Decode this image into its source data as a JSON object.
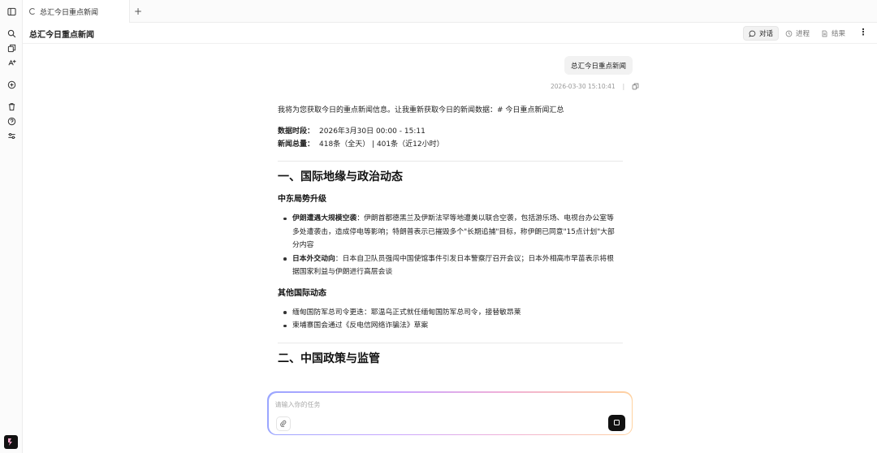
{
  "tab": {
    "title": "总汇今日重点新闻",
    "add_label": "+"
  },
  "header": {
    "title": "总汇今日重点新闻",
    "segments": [
      {
        "label": "对话",
        "icon": "chat-icon",
        "active": true
      },
      {
        "label": "进程",
        "icon": "progress-icon",
        "active": false
      },
      {
        "label": "结果",
        "icon": "document-icon",
        "active": false
      }
    ],
    "more_label": "⋮"
  },
  "user_message": {
    "text": "总汇今日重点新闻",
    "timestamp": "2026-03-30 15:10:41",
    "separator": "|"
  },
  "answer": {
    "intro": "我将为您获取今日的重点新闻信息。让我重新获取今日的新闻数据：# 今日重点新闻汇总",
    "period_label": "数据时段：",
    "period_value": "2026年3月30日 00:00 - 15:11",
    "total_label": "新闻总量：",
    "total_value": "418条（全天） | 401条（近12小时）",
    "section1": {
      "title": "一、国际地缘与政治动态",
      "sub1": {
        "title": "中东局势升级",
        "items": [
          {
            "bold": "伊朗遭遇大规模空袭",
            "text_lines": [
              "：伊朗首都德黑兰及伊斯法罕等地遭美以联合空袭，包括游乐场、电视台办公室等",
              "多处遭袭击，造成停电等影响；特朗普表示已摧毁多个\"长期追捕\"目标，称伊朗已同意\"15点计划\"大部",
              "分内容"
            ]
          },
          {
            "bold": "日本外交动向",
            "text_lines": [
              "：日本自卫队员强闯中国使馆事件引发日本警察厅召开会议；日本外相高市早苗表示将根",
              "据国家利益与伊朗进行高层会谈"
            ]
          }
        ]
      },
      "sub2": {
        "title": "其他国际动态",
        "items": [
          "缅甸国防军总司令更迭：耶温乌正式就任缅甸国防军总司令，接替敏昂莱",
          "柬埔寨国会通过《反电信网络诈骗法》草案"
        ]
      }
    },
    "section2": {
      "title": "二、中国政策与监管"
    }
  },
  "composer": {
    "placeholder": "请输入你的任务",
    "value": ""
  },
  "colors": {
    "accent_gradient": [
      "#9aa6ff",
      "#c9a6ff",
      "#f0b0d8",
      "#ffd2a0"
    ],
    "stop_button": "#111111"
  }
}
